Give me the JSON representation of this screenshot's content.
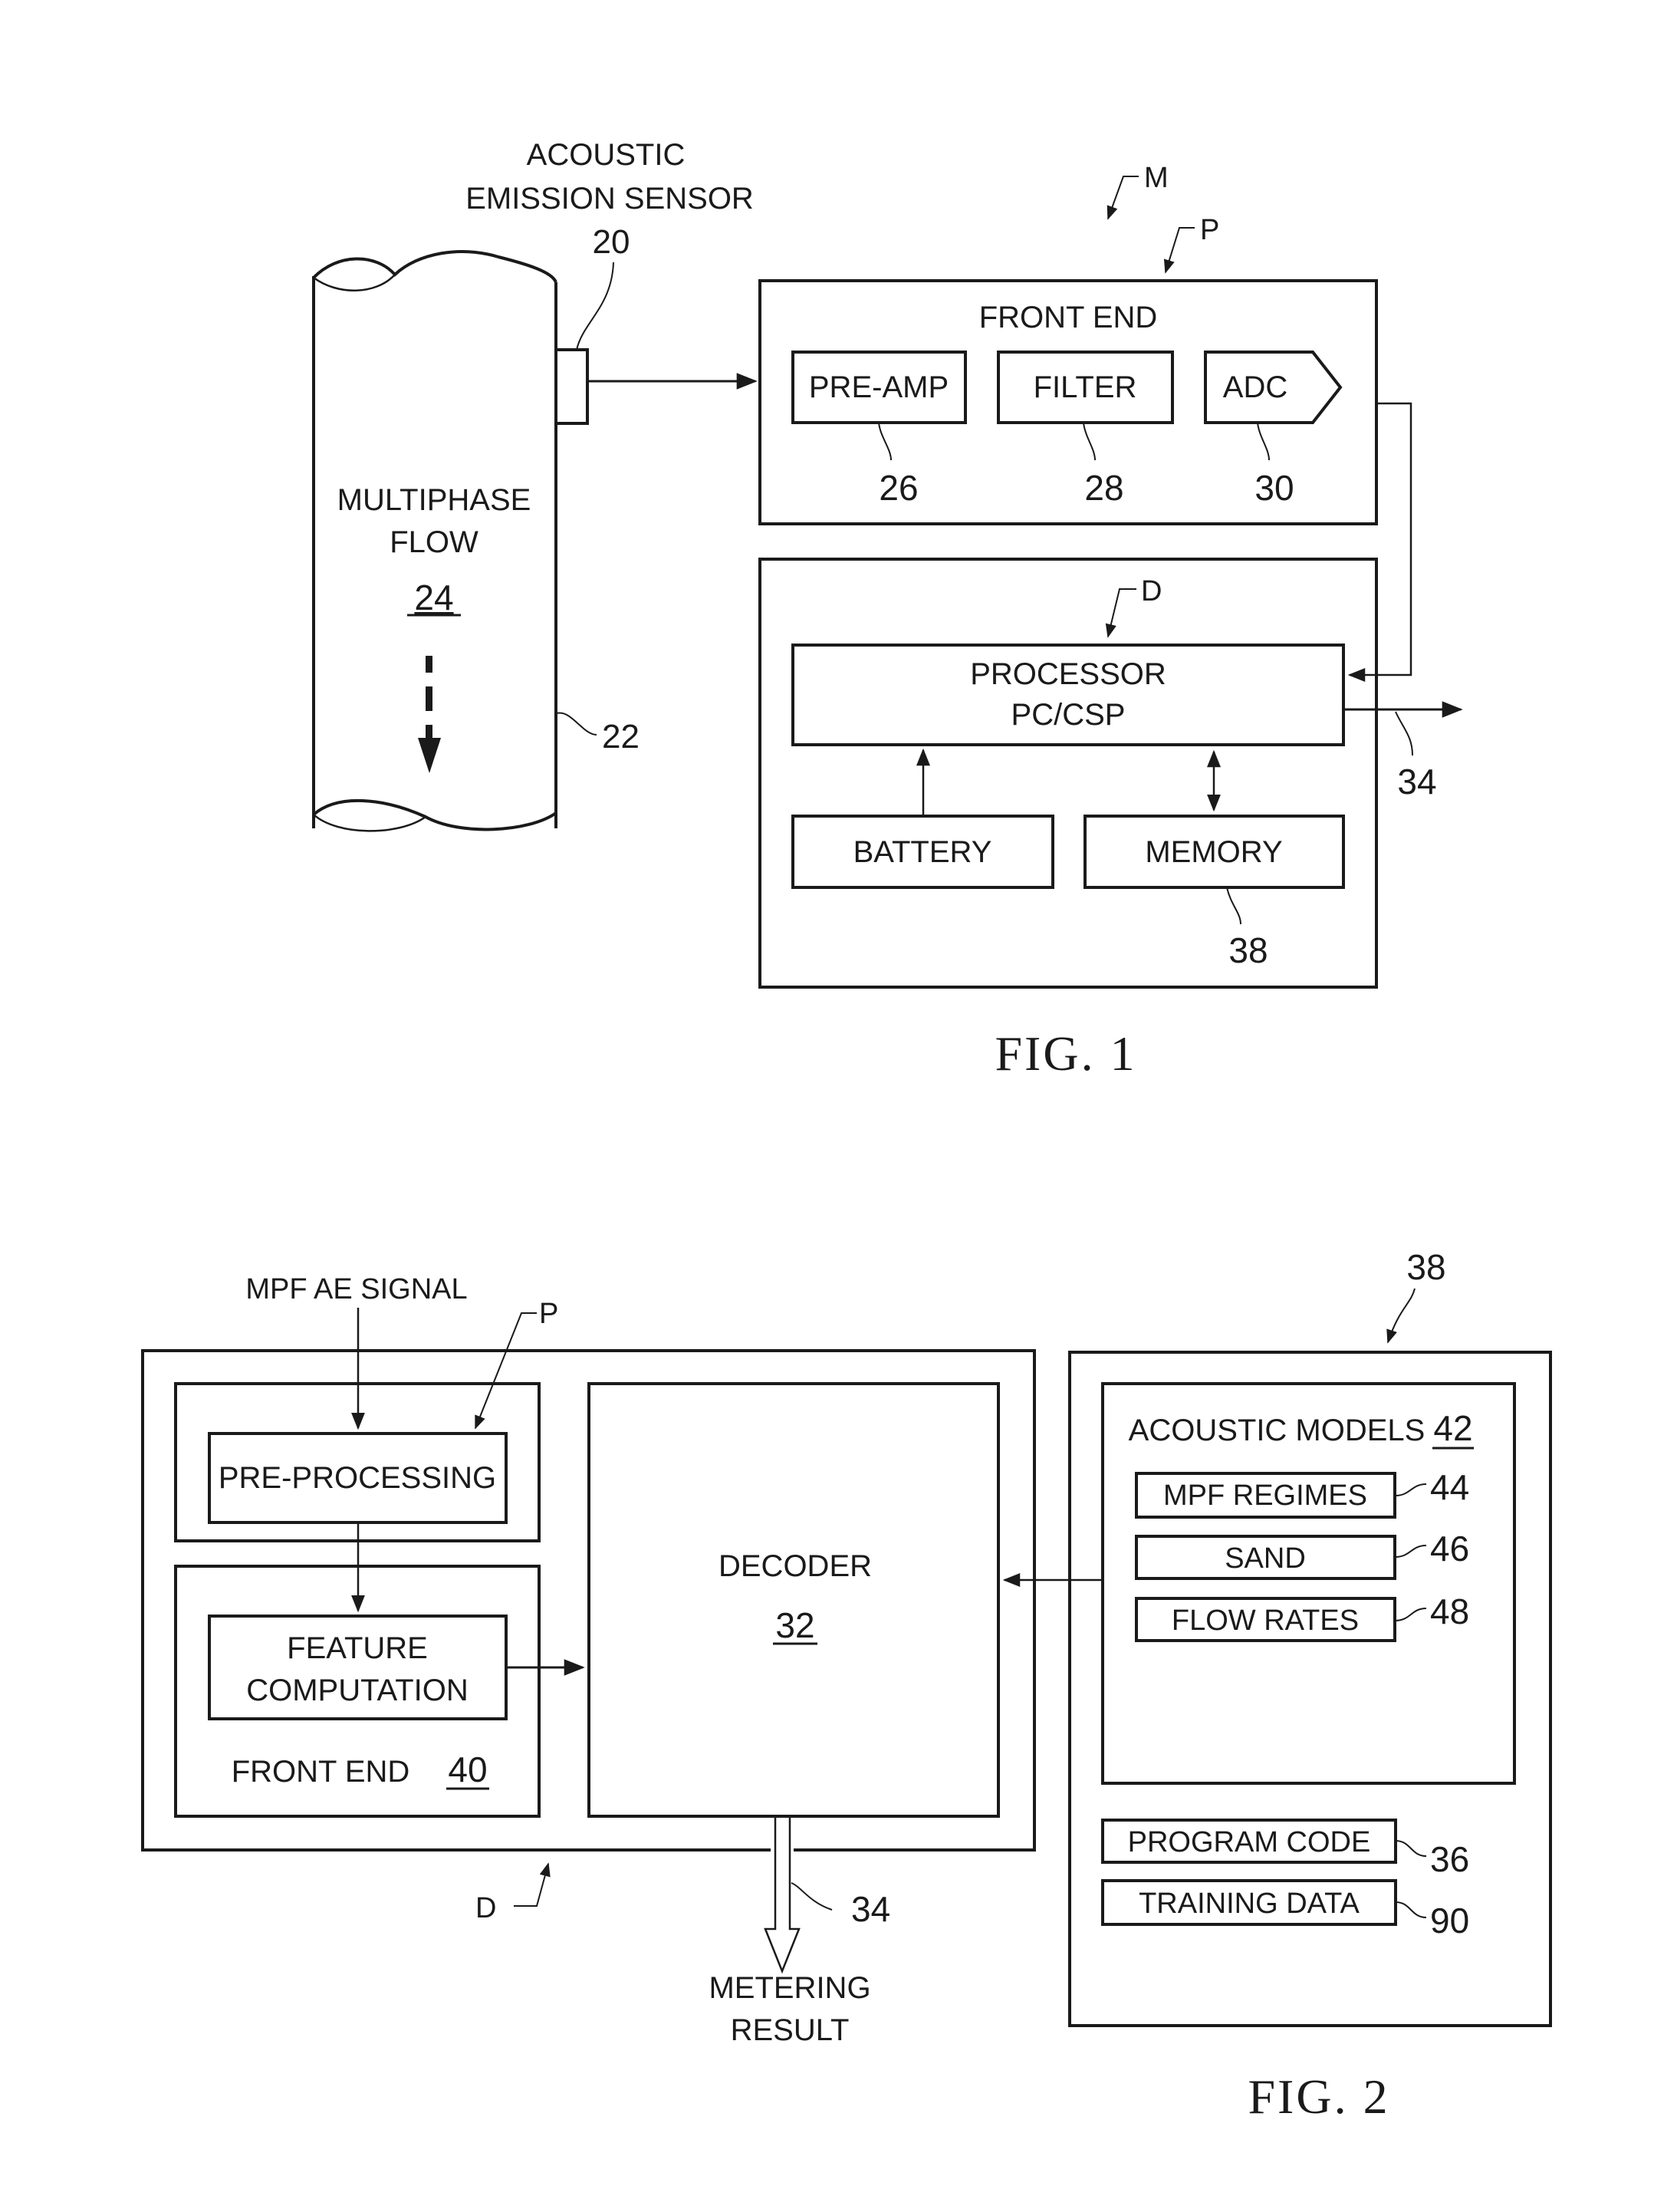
{
  "fig1": {
    "caption": "FIG. 1",
    "system_ref": "M",
    "sensor": {
      "label_line1": "ACOUSTIC",
      "label_line2": "EMISSION SENSOR",
      "ref": "20"
    },
    "pipe": {
      "flow_line1": "MULTIPHASE",
      "flow_line2": "FLOW",
      "flow_ref": "24",
      "pipe_ref": "22"
    },
    "front_end": {
      "ref": "P",
      "title": "FRONT END",
      "blocks": [
        {
          "label": "PRE-AMP",
          "ref": "26"
        },
        {
          "label": "FILTER",
          "ref": "28"
        },
        {
          "label": "ADC",
          "ref": "30"
        }
      ]
    },
    "processing_unit": {
      "ref": "D",
      "processor_line1": "PROCESSOR",
      "processor_line2": "PC/CSP",
      "battery": "BATTERY",
      "memory": "MEMORY",
      "memory_ref": "38",
      "output_ref": "34"
    }
  },
  "fig2": {
    "caption": "FIG. 2",
    "input_signal": "MPF AE SIGNAL",
    "preprocessing_ref": "P",
    "preprocessing": "PRE-PROCESSING",
    "feature_line1": "FEATURE",
    "feature_line2": "COMPUTATION",
    "front_end": "FRONT END",
    "front_end_ref": "40",
    "decoder": "DECODER",
    "decoder_ref": "32",
    "decoder_unit_ref": "D",
    "output_ref": "34",
    "output_line1": "METERING",
    "output_line2": "RESULT",
    "memory_ref": "38",
    "acoustic_models": "ACOUSTIC MODELS",
    "acoustic_models_ref": "42",
    "models": [
      {
        "label": "MPF REGIMES",
        "ref": "44"
      },
      {
        "label": "SAND",
        "ref": "46"
      },
      {
        "label": "FLOW RATES",
        "ref": "48"
      }
    ],
    "program_code": "PROGRAM CODE",
    "program_code_ref": "36",
    "training_data": "TRAINING DATA",
    "training_data_ref": "90"
  }
}
